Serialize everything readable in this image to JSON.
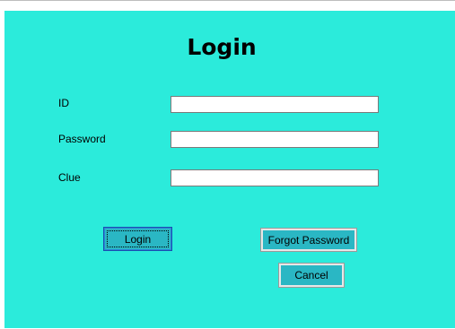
{
  "window": {
    "background_color": "#2bebdb"
  },
  "form": {
    "title": "Login",
    "fields": [
      {
        "label": "ID",
        "value": "",
        "placeholder": ""
      },
      {
        "label": "Password",
        "value": "",
        "placeholder": ""
      },
      {
        "label": "Clue",
        "value": "",
        "placeholder": ""
      }
    ],
    "buttons": {
      "login_label": "Login",
      "forgot_label": "Forgot Password",
      "cancel_label": "Cancel"
    }
  },
  "colors": {
    "form_background": "#2bebdb",
    "button_face": "#2ab7c4",
    "focus_border": "#1a4fb0"
  }
}
